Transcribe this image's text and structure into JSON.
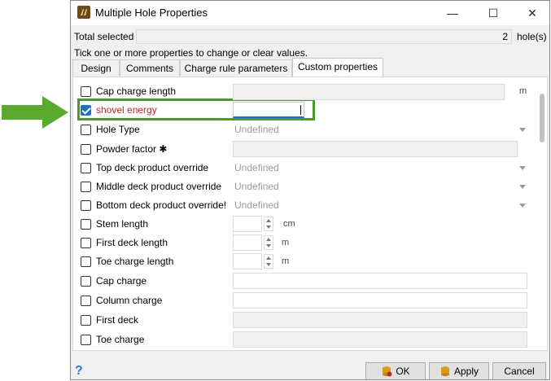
{
  "window": {
    "title": "Multiple Hole Properties"
  },
  "total": {
    "label": "Total selected",
    "value": "2",
    "unit": "hole(s)"
  },
  "hint": "Tick one or more properties to change or clear values.",
  "tabs": [
    "Design",
    "Comments",
    "Charge rule parameters",
    "Custom properties"
  ],
  "properties": [
    {
      "label": "Cap charge length",
      "checked": false,
      "unit": "m"
    },
    {
      "label": "shovel energy",
      "checked": true
    },
    {
      "label": "Hole Type",
      "value": "Undefined"
    },
    {
      "label": "Powder factor",
      "marker": "✱"
    },
    {
      "label": "Top deck product override",
      "value": "Undefined"
    },
    {
      "label": "Middle deck product override",
      "value": "Undefined"
    },
    {
      "label": "Bottom deck product override!",
      "value": "Undefined"
    },
    {
      "label": "Stem length",
      "unit": "cm"
    },
    {
      "label": "First deck length",
      "unit": "m"
    },
    {
      "label": "Toe charge length",
      "unit": "m"
    },
    {
      "label": "Cap charge"
    },
    {
      "label": "Column charge"
    },
    {
      "label": "First deck"
    },
    {
      "label": "Toe charge"
    }
  ],
  "buttons": {
    "ok": "OK",
    "apply": "Apply",
    "cancel": "Cancel"
  },
  "colors": {
    "accent": "#1d6fc4",
    "highlight": "#4c9a2a",
    "checked_label": "#d11f1f"
  },
  "titlebar_controls": {
    "minimize": "—",
    "maximize": "☐",
    "close": "✕"
  },
  "help_icon": "?"
}
